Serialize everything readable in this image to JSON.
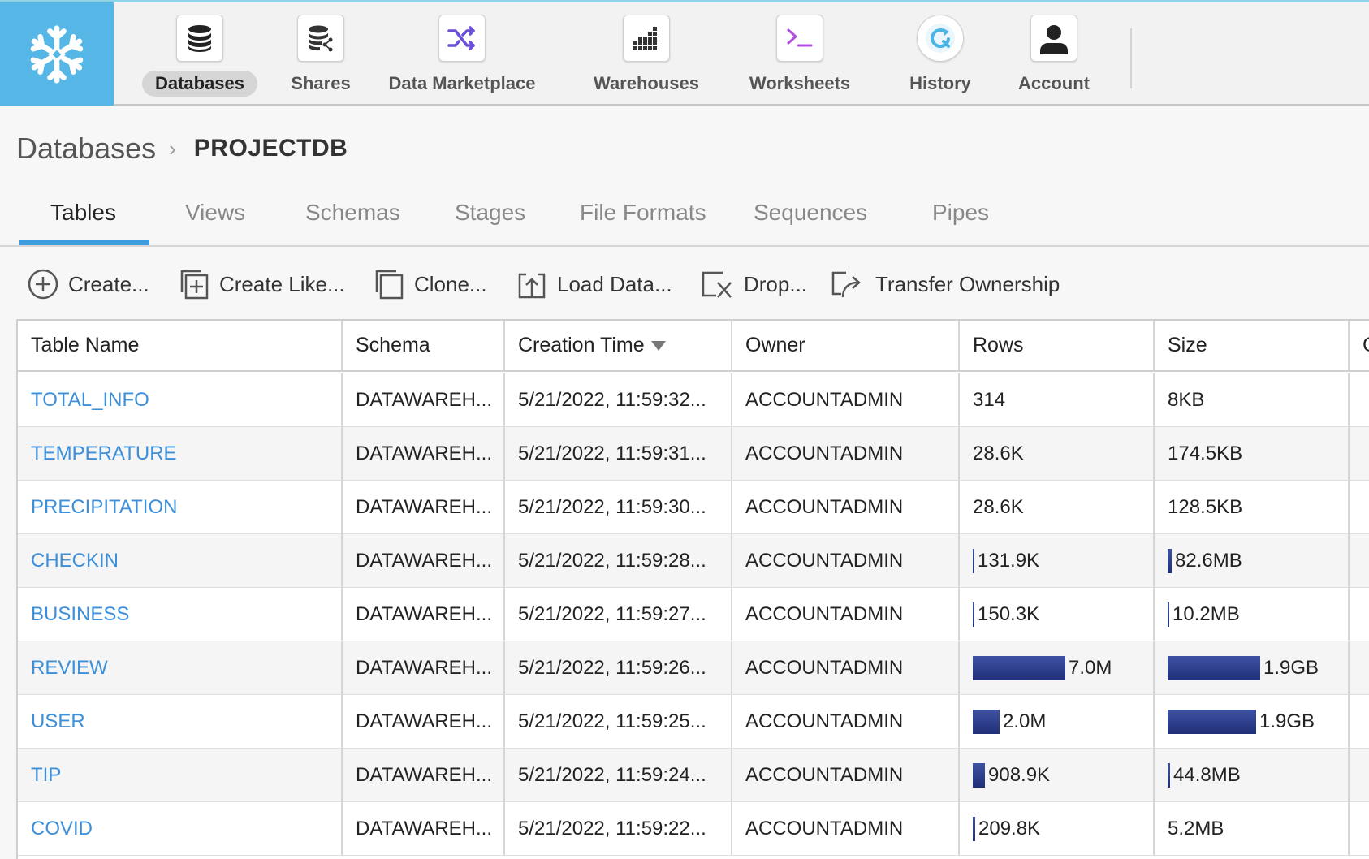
{
  "nav": {
    "items": [
      {
        "label": "Databases",
        "icon": "database-icon",
        "active": true
      },
      {
        "label": "Shares",
        "icon": "shares-icon"
      },
      {
        "label": "Data Marketplace",
        "icon": "marketplace-shuffle-icon"
      },
      {
        "label": "Warehouses",
        "icon": "warehouse-grid-icon"
      },
      {
        "label": "Worksheets",
        "icon": "terminal-prompt-icon"
      },
      {
        "label": "History",
        "icon": "history-refresh-icon"
      },
      {
        "label": "Account",
        "icon": "user-silhouette-icon"
      }
    ]
  },
  "breadcrumb": {
    "root": "Databases",
    "current": "PROJECTDB"
  },
  "tabs": [
    "Tables",
    "Views",
    "Schemas",
    "Stages",
    "File Formats",
    "Sequences",
    "Pipes"
  ],
  "active_tab": "Tables",
  "toolbar": {
    "create": "Create...",
    "create_like": "Create Like...",
    "clone": "Clone...",
    "load_data": "Load Data...",
    "drop": "Drop...",
    "transfer_ownership": "Transfer Ownership"
  },
  "table": {
    "columns": [
      "Table Name",
      "Schema",
      "Creation Time",
      "Owner",
      "Rows",
      "Size",
      "C"
    ],
    "sort_column": "Creation Time",
    "rows": [
      {
        "name": "TOTAL_INFO",
        "schema": "DATAWAREH...",
        "created": "5/21/2022, 11:59:32...",
        "owner": "ACCOUNTADMIN",
        "rows": "314",
        "rows_fraction": 0,
        "size": "8KB",
        "size_fraction": 0
      },
      {
        "name": "TEMPERATURE",
        "schema": "DATAWAREH...",
        "created": "5/21/2022, 11:59:31...",
        "owner": "ACCOUNTADMIN",
        "rows": "28.6K",
        "rows_fraction": 0,
        "size": "174.5KB",
        "size_fraction": 0
      },
      {
        "name": "PRECIPITATION",
        "schema": "DATAWAREH...",
        "created": "5/21/2022, 11:59:30...",
        "owner": "ACCOUNTADMIN",
        "rows": "28.6K",
        "rows_fraction": 0,
        "size": "128.5KB",
        "size_fraction": 0
      },
      {
        "name": "CHECKIN",
        "schema": "DATAWAREH...",
        "created": "5/21/2022, 11:59:28...",
        "owner": "ACCOUNTADMIN",
        "rows": "131.9K",
        "rows_fraction": 0.019,
        "size": "82.6MB",
        "size_fraction": 0.042
      },
      {
        "name": "BUSINESS",
        "schema": "DATAWAREH...",
        "created": "5/21/2022, 11:59:27...",
        "owner": "ACCOUNTADMIN",
        "rows": "150.3K",
        "rows_fraction": 0.021,
        "size": "10.2MB",
        "size_fraction": 0.005
      },
      {
        "name": "REVIEW",
        "schema": "DATAWAREH...",
        "created": "5/21/2022, 11:59:26...",
        "owner": "ACCOUNTADMIN",
        "rows": "7.0M",
        "rows_fraction": 1.0,
        "size": "1.9GB",
        "size_fraction": 1.0
      },
      {
        "name": "USER",
        "schema": "DATAWAREH...",
        "created": "5/21/2022, 11:59:25...",
        "owner": "ACCOUNTADMIN",
        "rows": "2.0M",
        "rows_fraction": 0.286,
        "size": "1.9GB",
        "size_fraction": 0.96
      },
      {
        "name": "TIP",
        "schema": "DATAWAREH...",
        "created": "5/21/2022, 11:59:24...",
        "owner": "ACCOUNTADMIN",
        "rows": "908.9K",
        "rows_fraction": 0.13,
        "size": "44.8MB",
        "size_fraction": 0.023
      },
      {
        "name": "COVID",
        "schema": "DATAWAREH...",
        "created": "5/21/2022, 11:59:22...",
        "owner": "ACCOUNTADMIN",
        "rows": "209.8K",
        "rows_fraction": 0.03,
        "size": "5.2MB",
        "size_fraction": 0
      }
    ]
  },
  "colors": {
    "logo_bg": "#56b7e6",
    "link": "#3d8fd9",
    "tab_underline": "#3d9be0",
    "bar": "#2b3b8c",
    "worksheets_icon": "#b24fe0",
    "marketplace_icon": "#6b4fd8",
    "history_icon": "#4ab4e6"
  }
}
